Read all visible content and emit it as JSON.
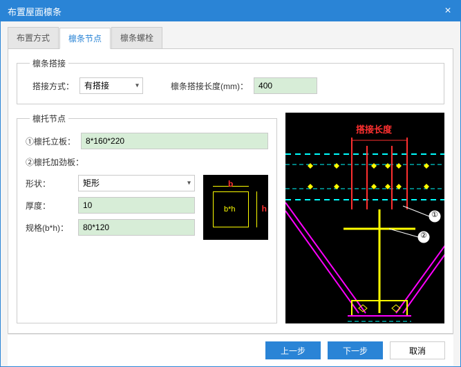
{
  "titlebar": {
    "title": "布置屋面檩条"
  },
  "tabs": [
    {
      "label": "布置方式"
    },
    {
      "label": "檩条节点"
    },
    {
      "label": "檩条螺栓"
    }
  ],
  "splice": {
    "legend": "檩条搭接",
    "method_label": "搭接方式：",
    "method_value": "有搭接",
    "length_label": "檩条搭接长度(mm)：",
    "length_value": "400"
  },
  "bracket": {
    "legend": "檩托节点",
    "plate_label": "①檩托立板：",
    "plate_value": "8*160*220",
    "stiffener_label": "②檩托加劲板：",
    "shape_label": "形状：",
    "shape_value": "矩形",
    "thickness_label": "厚度：",
    "thickness_value": "10",
    "spec_label": "规格(b*h)：",
    "spec_value": "80*120"
  },
  "preview": {
    "b": "b",
    "h": "h",
    "bh": "b*h"
  },
  "diagram": {
    "splice_length_label": "搭接长度",
    "ref1": "①",
    "ref2": "②"
  },
  "footer": {
    "prev": "上一步",
    "next": "下一步",
    "cancel": "取消"
  }
}
